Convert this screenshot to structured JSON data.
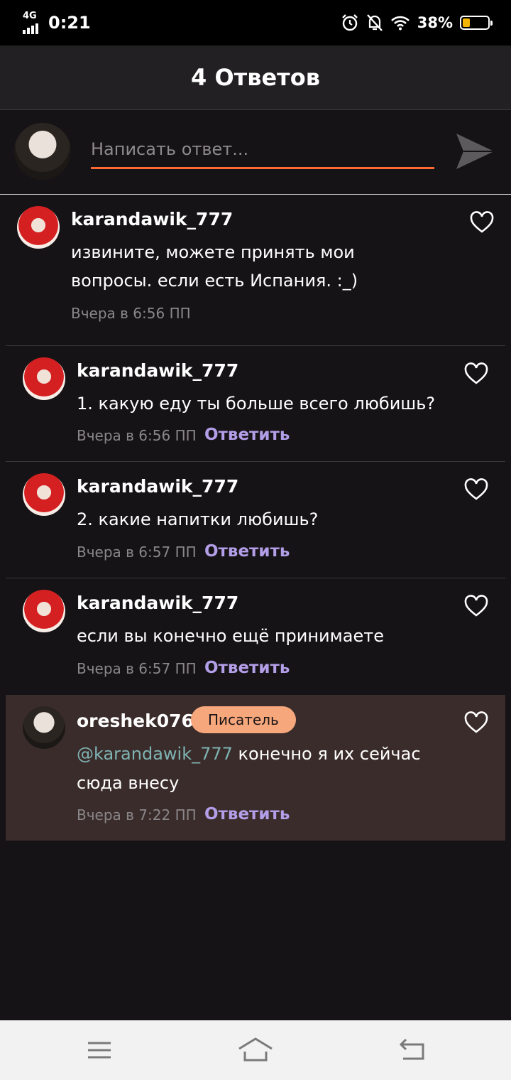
{
  "status_bar": {
    "network": "4G",
    "time": "0:21",
    "battery_percent": "38%",
    "battery_level": 0.38,
    "icons": [
      "alarm-icon",
      "silent-bell-icon",
      "wifi-icon",
      "battery-icon"
    ]
  },
  "header": {
    "title": "4 Ответов"
  },
  "compose": {
    "placeholder": "Написать ответ...",
    "accent_color": "#ff6b35"
  },
  "comments": [
    {
      "username": "karandawik_777",
      "text": "извините, можете принять мои вопросы. если есть Испания. :_)",
      "line1": "извините, можете принять мои",
      "line2": "вопросы. если есть Испания. :_)",
      "time": "Вчера в 6:56 ПП"
    },
    {
      "username": "karandawik_777",
      "text": "1. какую еду ты больше всего любишь?",
      "time": "Вчера в 6:56 ПП",
      "reply_label": "Ответить"
    },
    {
      "username": "karandawik_777",
      "text": "2. какие напитки любишь?",
      "time": "Вчера в 6:57 ПП",
      "reply_label": "Ответить"
    },
    {
      "username": "karandawik_777",
      "text": "если вы конечно ещё принимаете",
      "time": "Вчера в 6:57 ПП",
      "reply_label": "Ответить"
    },
    {
      "username": "oreshek076",
      "badge": "Писатель",
      "mention": "@karandawik_777",
      "text_after_mention": " конечно я их сейчас",
      "line2": "сюда внесу",
      "time": "Вчера в 7:22 ПП",
      "reply_label": "Ответить"
    }
  ],
  "colors": {
    "background": "#161316",
    "reply_link": "#b39ee8",
    "badge": "#f7a77c",
    "mention": "#7fb3b3",
    "highlight": "#3a2c2a"
  }
}
